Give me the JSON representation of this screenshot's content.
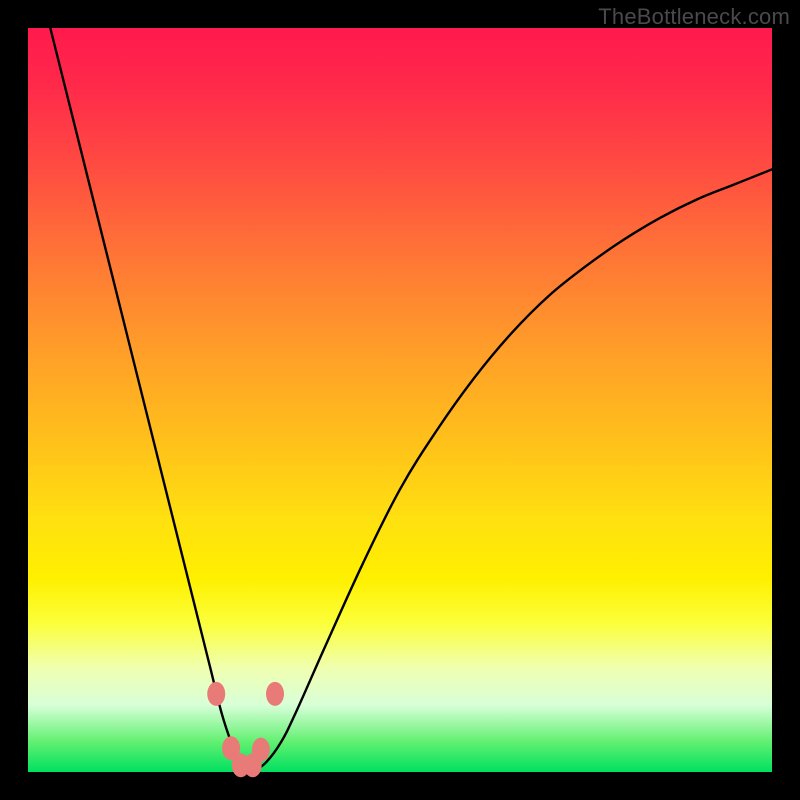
{
  "watermark": "TheBottleneck.com",
  "colors": {
    "frame_bg_top": "#ff1a4d",
    "frame_bg_bottom": "#00e060",
    "curve_stroke": "#000000",
    "marker_fill": "#e87a78",
    "marker_stroke": "#d46462"
  },
  "chart_data": {
    "type": "line",
    "title": "",
    "xlabel": "",
    "ylabel": "",
    "xlim": [
      0,
      100
    ],
    "ylim": [
      0,
      100
    ],
    "grid": false,
    "legend": false,
    "annotations": [],
    "series": [
      {
        "name": "curve",
        "x": [
          3,
          5,
          8,
          11,
          14,
          17,
          19,
          21,
          23,
          24.5,
          26,
          27.3,
          28.5,
          29.5,
          30.5,
          32,
          34,
          36,
          40,
          45,
          50,
          55,
          60,
          65,
          70,
          75,
          80,
          85,
          90,
          95,
          100
        ],
        "y": [
          100,
          92,
          80,
          68,
          56,
          44,
          36,
          28,
          20,
          14,
          8,
          4,
          1.2,
          0.3,
          0.3,
          1.3,
          4,
          8,
          17,
          28,
          38,
          46,
          53,
          59,
          64,
          68,
          71.5,
          74.5,
          77,
          79,
          81
        ]
      }
    ],
    "markers": [
      {
        "x": 25.3,
        "y": 10.5
      },
      {
        "x": 33.2,
        "y": 10.5
      },
      {
        "x": 27.3,
        "y": 3.2
      },
      {
        "x": 31.3,
        "y": 3.0
      },
      {
        "x": 28.6,
        "y": 0.9
      },
      {
        "x": 30.2,
        "y": 0.9
      }
    ]
  }
}
